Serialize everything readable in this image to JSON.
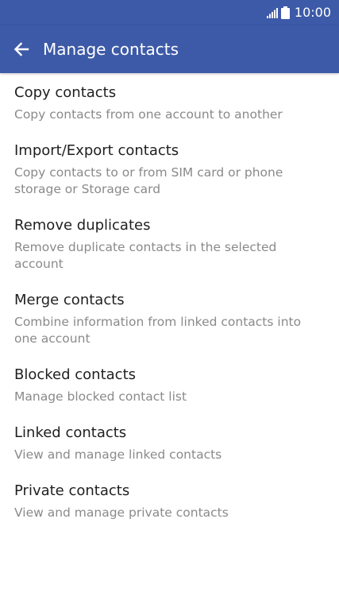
{
  "status_bar": {
    "time": "10:00",
    "signal_icon": "signal-icon",
    "battery_icon": "battery-icon"
  },
  "header": {
    "title": "Manage contacts",
    "back_icon": "arrow-left-icon"
  },
  "colors": {
    "header_background": "#3d5aa8",
    "title_text": "#1f1f1f",
    "description_text": "#8a8a8a"
  },
  "menu": {
    "items": [
      {
        "title": "Copy contacts",
        "description": "Copy contacts from one account to another"
      },
      {
        "title": "Import/Export contacts",
        "description": "Copy contacts to or from SIM card or phone storage or Storage card"
      },
      {
        "title": "Remove duplicates",
        "description": "Remove duplicate contacts in the selected account"
      },
      {
        "title": "Merge contacts",
        "description": "Combine information from linked contacts into one account"
      },
      {
        "title": "Blocked contacts",
        "description": "Manage blocked contact list"
      },
      {
        "title": "Linked contacts",
        "description": "View and manage linked contacts"
      },
      {
        "title": "Private contacts",
        "description": "View and manage private contacts"
      }
    ]
  }
}
